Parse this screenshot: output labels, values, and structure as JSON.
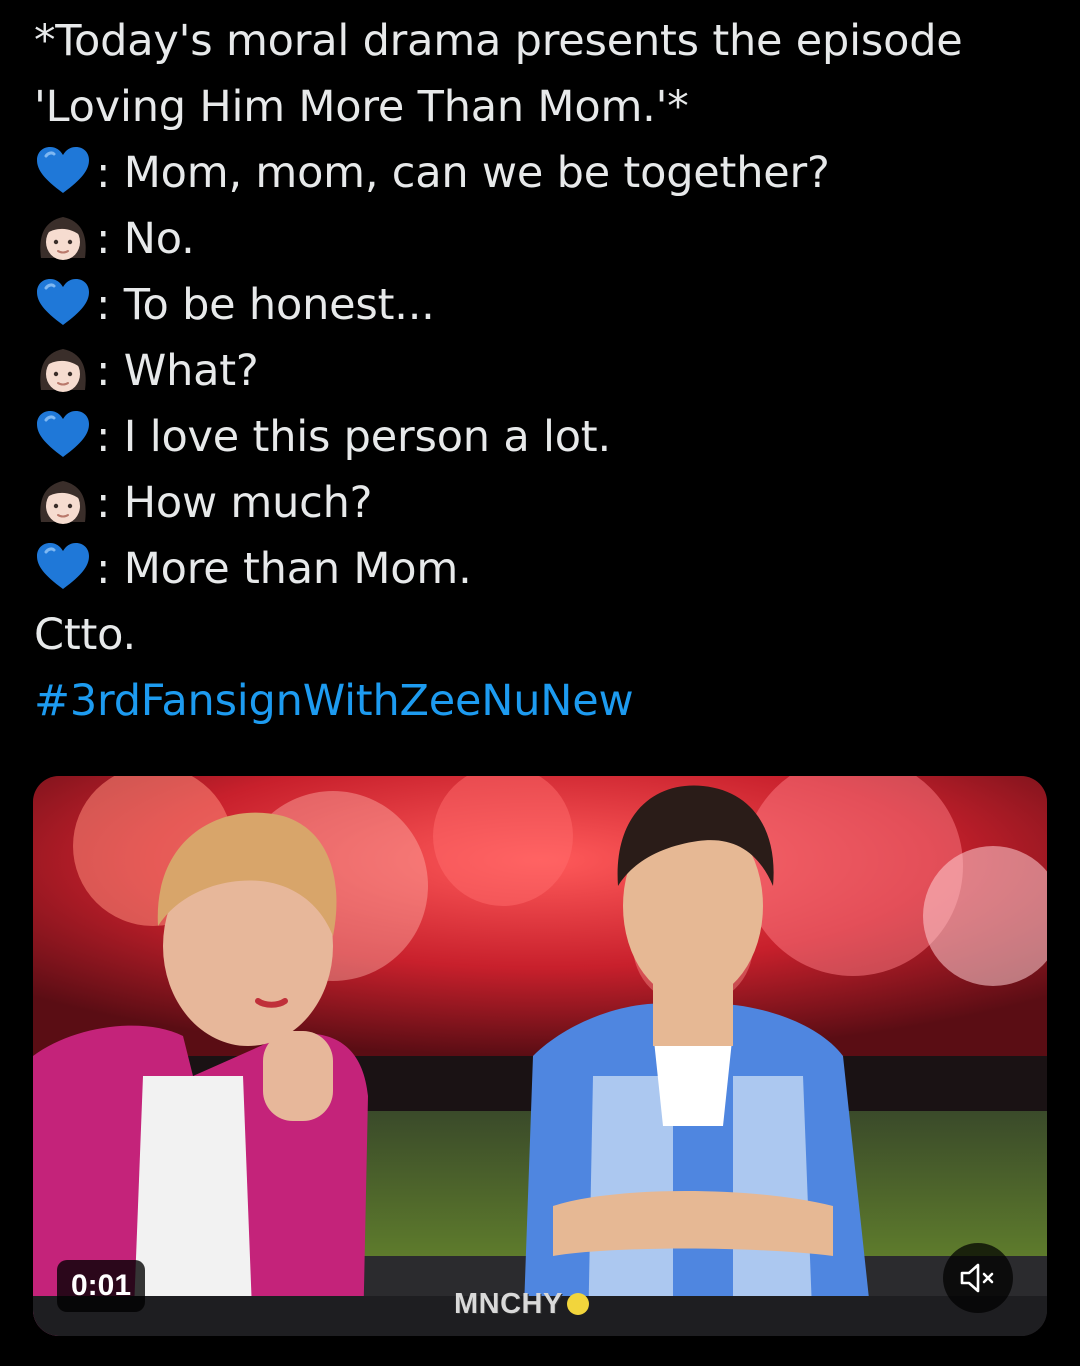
{
  "tweet": {
    "lines": [
      {
        "speaker": "",
        "text": "*Today's moral drama presents the episode"
      },
      {
        "speaker": "",
        "text": "'Loving Him More Than Mom.'*"
      },
      {
        "speaker": "blue-heart-icon",
        "text": ": Mom, mom, can we be together?"
      },
      {
        "speaker": "woman-face-icon",
        "text": ": No."
      },
      {
        "speaker": "blue-heart-icon",
        "text": ": To be honest..."
      },
      {
        "speaker": "woman-face-icon",
        "text": ": What?"
      },
      {
        "speaker": "blue-heart-icon",
        "text": ": I love this person a lot."
      },
      {
        "speaker": "woman-face-icon",
        "text": ": How much?"
      },
      {
        "speaker": "blue-heart-icon",
        "text": ": More than Mom."
      },
      {
        "speaker": "",
        "text": "Ctto."
      }
    ],
    "hashtag": "#3rdFansignWithZeeNuNew"
  },
  "video": {
    "elapsed_time": "0:01",
    "watermark": "MNCHY",
    "mute_icon": "speaker-muted-icon"
  },
  "colors": {
    "background": "#000000",
    "text": "#e7e9ea",
    "hashtag": "#1d9bf0",
    "blue_heart": "#1f78d8"
  }
}
